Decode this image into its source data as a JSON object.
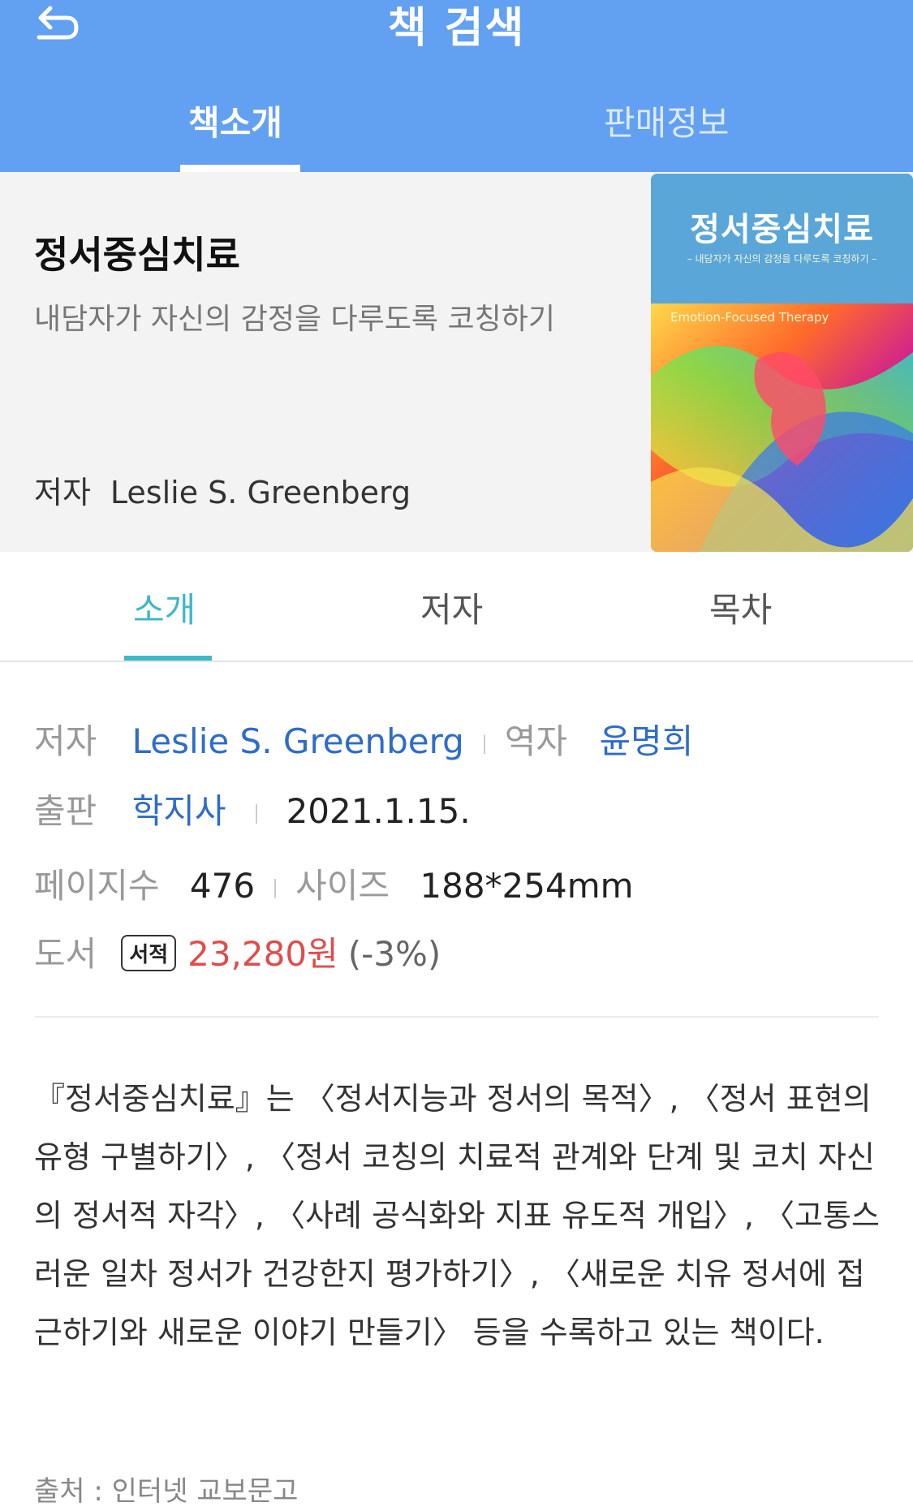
{
  "header": {
    "title": "책 검색",
    "back_icon": "back-arrow-icon",
    "tabs": [
      {
        "label": "책소개",
        "active": true
      },
      {
        "label": "판매정보",
        "active": false
      }
    ]
  },
  "book": {
    "title": "정서중심치료",
    "subtitle": "내담자가 자신의 감정을 다루도록 코칭하기",
    "author_label": "저자",
    "author": "Leslie S. Greenberg",
    "cover": {
      "title": "정서중심치료",
      "subtitle": "– 내담자가 자신의 감정을 다루도록 코칭하기 –",
      "english_title": "Emotion-Focused Therapy"
    }
  },
  "sub_tabs": [
    {
      "label": "소개",
      "active": true
    },
    {
      "label": "저자",
      "active": false
    },
    {
      "label": "목차",
      "active": false
    }
  ],
  "info": {
    "author_label": "저자",
    "author": "Leslie S. Greenberg",
    "translator_label": "역자",
    "translator": "윤명희",
    "publisher_label": "출판",
    "publisher": "학지사",
    "date": "2021.1.15.",
    "pages_label": "페이지수",
    "pages": "476",
    "size_label": "사이즈",
    "size": "188*254mm",
    "price_label": "도서",
    "badge": "서적",
    "price": "23,280원",
    "discount": "(-3%)"
  },
  "description": "『정서중심치료』는 〈정서지능과 정서의 목적〉, 〈정서 표현의 유형 구별하기〉, 〈정서 코칭의 치료적 관계와 단계 및 코치 자신의 정서적 자각〉, 〈사례 공식화와 지표 유도적 개입〉, 〈고통스러운 일차 정서가 건강한지 평가하기〉, 〈새로운 치유 정서에 접근하기와 새로운 이야기 만들기〉 등을 수록하고 있는 책이다.",
  "source": "출처 : 인터넷 교보문고",
  "colors": {
    "header": "#62a0f2",
    "accent": "#3fb7c6",
    "link": "#2e6cc9",
    "price": "#e24b4b"
  }
}
